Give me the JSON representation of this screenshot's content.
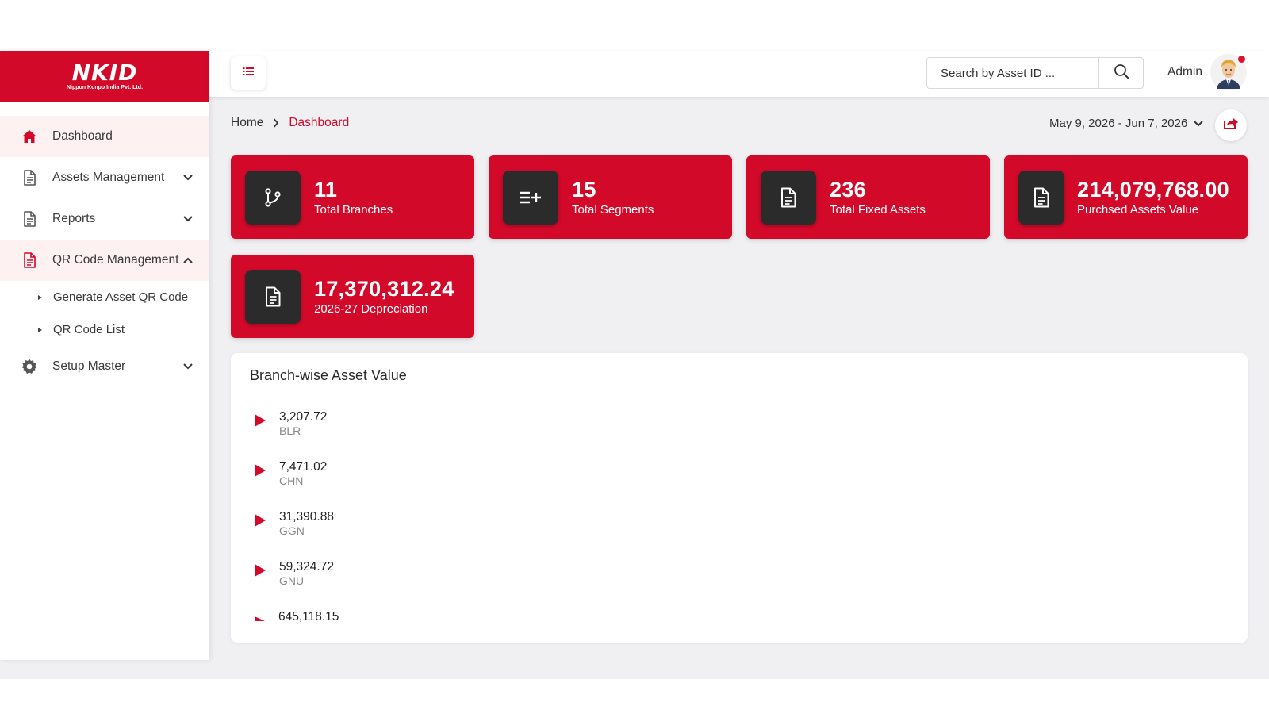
{
  "brand": {
    "name": "NKID",
    "subtitle": "Nippon Konpo India Pvt. Ltd."
  },
  "sidebar": {
    "items": [
      {
        "label": "Dashboard",
        "icon": "home-icon"
      },
      {
        "label": "Assets Management",
        "icon": "document-icon"
      },
      {
        "label": "Reports",
        "icon": "document-icon"
      },
      {
        "label": "QR Code Management",
        "icon": "document-icon"
      },
      {
        "label": "Setup Master",
        "icon": "gear-icon"
      }
    ],
    "qr_sub": [
      {
        "label": "Generate Asset QR Code"
      },
      {
        "label": "QR Code List"
      }
    ]
  },
  "header": {
    "search_placeholder": "Search by Asset ID ...",
    "user_name": "Admin"
  },
  "breadcrumb": {
    "home": "Home",
    "current": "Dashboard"
  },
  "date_range": "May 9, 2026 - Jun 7, 2026",
  "stats": [
    {
      "value": "11",
      "label": "Total Branches",
      "icon": "branch-icon"
    },
    {
      "value": "15",
      "label": "Total Segments",
      "icon": "list-add-icon"
    },
    {
      "value": "236",
      "label": "Total Fixed Assets",
      "icon": "document-icon"
    },
    {
      "value": "214,079,768.00",
      "label": "Purchsed Assets Value",
      "icon": "document-icon"
    },
    {
      "value": "17,370,312.24",
      "label": "2026-27 Depreciation",
      "icon": "document-icon"
    }
  ],
  "branch_panel": {
    "title": "Branch-wise Asset Value",
    "rows": [
      {
        "value": "3,207.72",
        "code": "BLR"
      },
      {
        "value": "7,471.02",
        "code": "CHN"
      },
      {
        "value": "31,390.88",
        "code": "GGN"
      },
      {
        "value": "59,324.72",
        "code": "GNU"
      },
      {
        "value": "645,118.15",
        "code": ""
      }
    ]
  },
  "colors": {
    "accent": "#d3092a",
    "icon_bg": "#2b2b2b",
    "page_bg": "#f0f0f3"
  }
}
